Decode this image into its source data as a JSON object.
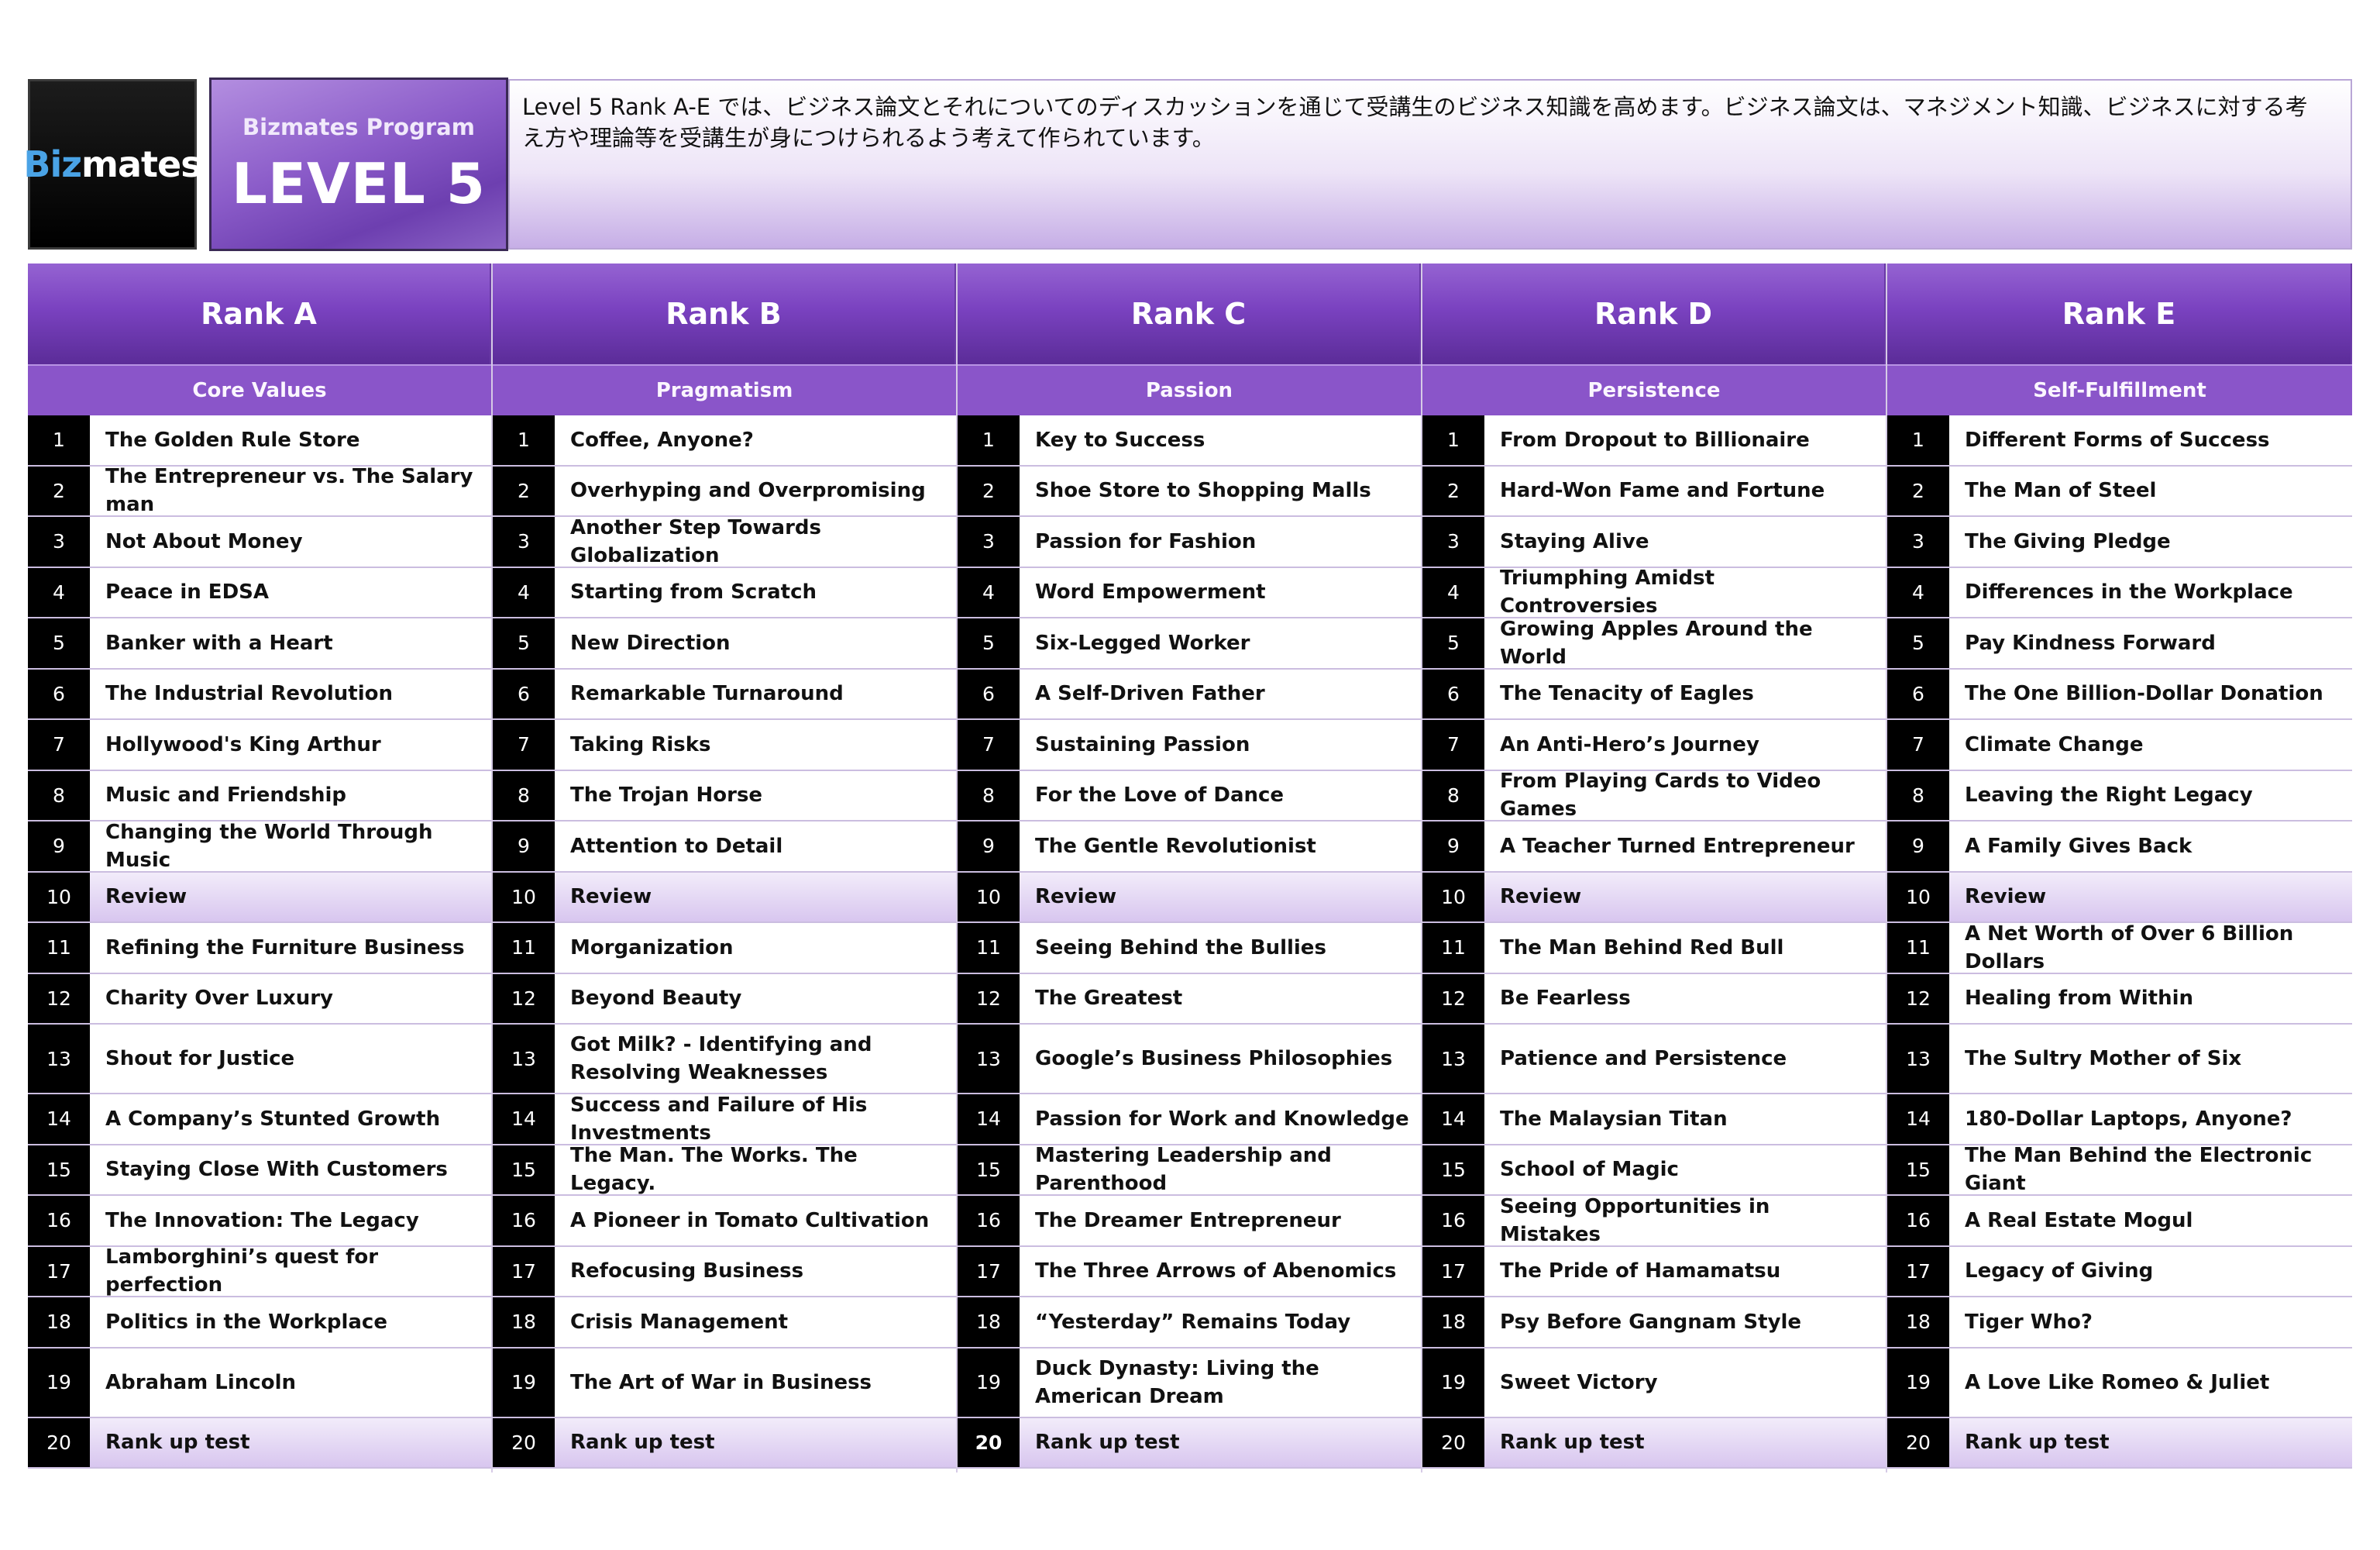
{
  "brand": {
    "logo_part1": "Biz",
    "logo_part2": "mates",
    "program_label": "Bizmates Program",
    "level_title": "LEVEL 5"
  },
  "intro_text": "Level 5 Rank A-E では、ビジネス論文とそれについてのディスカッションを通じて受講生のビジネス知識を高めます。ビジネス論文は、マネジメント知識、ビジネスに対する考え方や理論等を受講生が身につけられるよう考えて作られています。",
  "ranks": [
    {
      "name": "Rank A",
      "theme": "Core Values",
      "lessons": [
        "The Golden Rule Store",
        "The Entrepreneur vs. The Salary man",
        "Not About Money",
        "Peace in EDSA",
        "Banker with a Heart",
        "The Industrial Revolution",
        "Hollywood's King Arthur",
        "Music and Friendship",
        "Changing the World Through Music",
        "Review",
        "Refining the Furniture Business",
        "Charity Over Luxury",
        "Shout for Justice",
        "A Company’s Stunted Growth",
        "Staying Close With Customers",
        "The Innovation: The Legacy",
        "Lamborghini’s quest for perfection",
        "Politics in the Workplace",
        "Abraham Lincoln",
        "Rank up test"
      ]
    },
    {
      "name": "Rank B",
      "theme": "Pragmatism",
      "lessons": [
        "Coffee, Anyone?",
        "Overhyping and Overpromising",
        "Another Step Towards Globalization",
        "Starting from Scratch",
        "New Direction",
        "Remarkable Turnaround",
        "Taking Risks",
        "The Trojan Horse",
        "Attention to Detail",
        "Review",
        "Morganization",
        "Beyond Beauty",
        "Got Milk? - Identifying and Resolving Weaknesses",
        "Success and Failure of His Investments",
        "The Man. The Works. The Legacy.",
        "A Pioneer in Tomato Cultivation",
        "Refocusing Business",
        "Crisis Management",
        "The Art of War in Business",
        "Rank up test"
      ]
    },
    {
      "name": "Rank C",
      "theme": "Passion",
      "lessons": [
        "Key to Success",
        "Shoe Store to Shopping Malls",
        "Passion for Fashion",
        "Word Empowerment",
        "Six-Legged Worker",
        "A Self-Driven Father",
        "Sustaining Passion",
        "For the Love of Dance",
        "The Gentle Revolutionist",
        "Review",
        "Seeing Behind the Bullies",
        "The Greatest",
        "Google’s Business Philosophies",
        "Passion for Work and Knowledge",
        "Mastering Leadership and Parenthood",
        "The Dreamer Entrepreneur",
        "The Three Arrows of Abenomics",
        "“Yesterday” Remains Today",
        "Duck Dynasty: Living the American Dream",
        "Rank up test"
      ]
    },
    {
      "name": "Rank D",
      "theme": "Persistence",
      "lessons": [
        "From Dropout to Billionaire",
        "Hard-Won Fame and Fortune",
        "Staying Alive",
        "Triumphing Amidst Controversies",
        "Growing Apples Around the World",
        "The Tenacity of Eagles",
        "An Anti-Hero’s Journey",
        "From Playing Cards to Video Games",
        "A Teacher Turned Entrepreneur",
        "Review",
        "The Man Behind Red Bull",
        "Be Fearless",
        "Patience and Persistence",
        "The Malaysian Titan",
        "School of Magic",
        "Seeing Opportunities in Mistakes",
        "The Pride of Hamamatsu",
        "Psy Before Gangnam Style",
        "Sweet Victory",
        "Rank up test"
      ]
    },
    {
      "name": "Rank E",
      "theme": "Self-Fulfillment",
      "lessons": [
        "Different Forms of Success",
        "The Man of Steel",
        "The Giving Pledge",
        "Differences in the Workplace",
        "Pay Kindness Forward",
        "The One Billion-Dollar Donation",
        "Climate Change",
        "Leaving the Right Legacy",
        "A Family Gives Back",
        "Review",
        "A Net Worth of Over 6 Billion Dollars",
        "Healing from Within",
        "The Sultry Mother of Six",
        "180-Dollar Laptops, Anyone?",
        "The Man Behind the Electronic Giant",
        "A Real Estate Mogul",
        "Legacy of Giving",
        "Tiger Who?",
        "A Love Like Romeo & Juliet",
        "Rank up test"
      ]
    }
  ],
  "numbers": [
    "1",
    "2",
    "3",
    "4",
    "5",
    "6",
    "7",
    "8",
    "9",
    "10",
    "11",
    "12",
    "13",
    "14",
    "15",
    "16",
    "17",
    "18",
    "19",
    "20"
  ]
}
